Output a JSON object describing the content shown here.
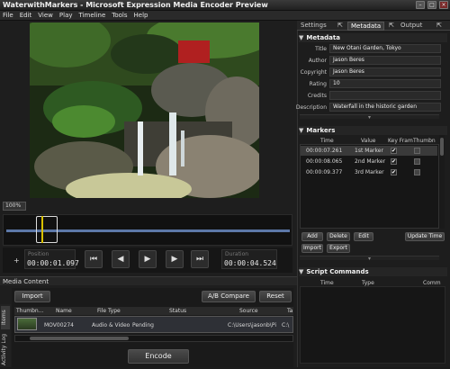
{
  "window": {
    "title": "WaterwithMarkers - Microsoft Expression Media Encoder Preview"
  },
  "menu": [
    "File",
    "Edit",
    "View",
    "Play",
    "Timeline",
    "Tools",
    "Help"
  ],
  "preview": {
    "zoom": "100%",
    "description": "Waterfall garden video frame"
  },
  "transport": {
    "position_label": "Position",
    "position_value": "00:00:01.097",
    "duration_label": "Duration",
    "duration_value": "00:00:04.524",
    "plus": "+"
  },
  "media": {
    "header": "Media Content",
    "import_label": "Import",
    "compare_label": "A/B Compare",
    "reset_label": "Reset",
    "encode_label": "Encode",
    "side_tabs": [
      "Items",
      "Activity Log"
    ],
    "columns": [
      "Thumbn...",
      "Name",
      "File Type",
      "Status",
      "Source",
      "Ta"
    ],
    "rows": [
      {
        "name": "MOV00274",
        "file_type": "Audio & Video",
        "status": "Pending",
        "source": "C:\\Users\\jasonb\\Pi",
        "target": "C:\\"
      }
    ]
  },
  "right": {
    "tabs": [
      "Settings",
      "Metadata",
      "Output"
    ],
    "metadata": {
      "title": "Metadata",
      "fields": [
        {
          "label": "Title",
          "value": "New Otani Garden, Tokyo"
        },
        {
          "label": "Author",
          "value": "Jason Beres"
        },
        {
          "label": "Copyright",
          "value": "Jason Beres"
        },
        {
          "label": "Rating",
          "value": "10"
        },
        {
          "label": "Credits",
          "value": ""
        },
        {
          "label": "Description",
          "value": "Waterfall in the historic garden"
        }
      ]
    },
    "markers": {
      "title": "Markers",
      "columns": [
        "Time",
        "Value",
        "Key Fram",
        "Thumbn"
      ],
      "rows": [
        {
          "time": "00:00:07.261",
          "value": "1st Marker",
          "key": "✔",
          "thumb": ""
        },
        {
          "time": "00:00:08.065",
          "value": "2nd Marker",
          "key": "✔",
          "thumb": ""
        },
        {
          "time": "00:00:09.377",
          "value": "3rd Marker",
          "key": "✔",
          "thumb": ""
        }
      ],
      "add_label": "Add",
      "delete_label": "Delete",
      "edit_label": "Edit",
      "update_label": "Update Time",
      "import_label": "Import",
      "export_label": "Export"
    },
    "script": {
      "title": "Script Commands",
      "columns": [
        "Time",
        "Type",
        "Comm"
      ]
    }
  }
}
